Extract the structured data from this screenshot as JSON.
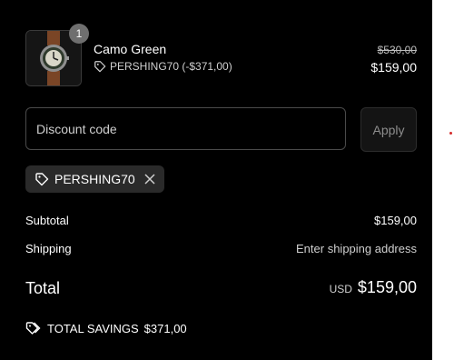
{
  "cart": {
    "item": {
      "quantity": "1",
      "name": "Camo Green",
      "discount_label": "PERSHING70 (-$371,00)",
      "price_original": "$530,00",
      "price_current": "$159,00",
      "thumbnail_icon": "watch-thumbnail"
    },
    "discount": {
      "placeholder": "Discount code",
      "apply_label": "Apply",
      "applied_code": "PERSHING70",
      "tag_icon": "tag-icon",
      "remove_icon": "close-icon"
    },
    "summary": {
      "subtotal_label": "Subtotal",
      "subtotal_value": "$159,00",
      "shipping_label": "Shipping",
      "shipping_value": "Enter shipping address",
      "total_label": "Total",
      "total_currency": "USD",
      "total_value": "$159,00",
      "savings_label": "TOTAL SAVINGS",
      "savings_value": "$371,00"
    }
  },
  "colors": {
    "panel_bg": "#000000",
    "text": "#ffffff",
    "muted_text": "#cfcfcf",
    "chip_bg": "#2a2a2a",
    "badge_bg": "#6f6f6f"
  }
}
